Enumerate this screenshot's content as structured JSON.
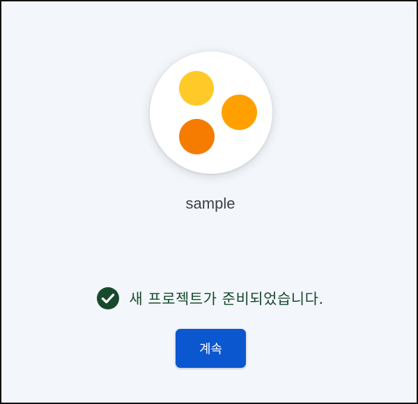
{
  "project": {
    "name": "sample",
    "logo_icon": "three-dots-logo-icon",
    "dot_colors": [
      "#ffca28",
      "#ffa000",
      "#f57c00"
    ]
  },
  "status": {
    "icon": "check-circle-icon",
    "icon_color": "#174a2c",
    "text": "새 프로젝트가 준비되었습니다.",
    "text_color": "#174a2c"
  },
  "actions": {
    "continue_label": "계속",
    "continue_color": "#0b57d0"
  }
}
